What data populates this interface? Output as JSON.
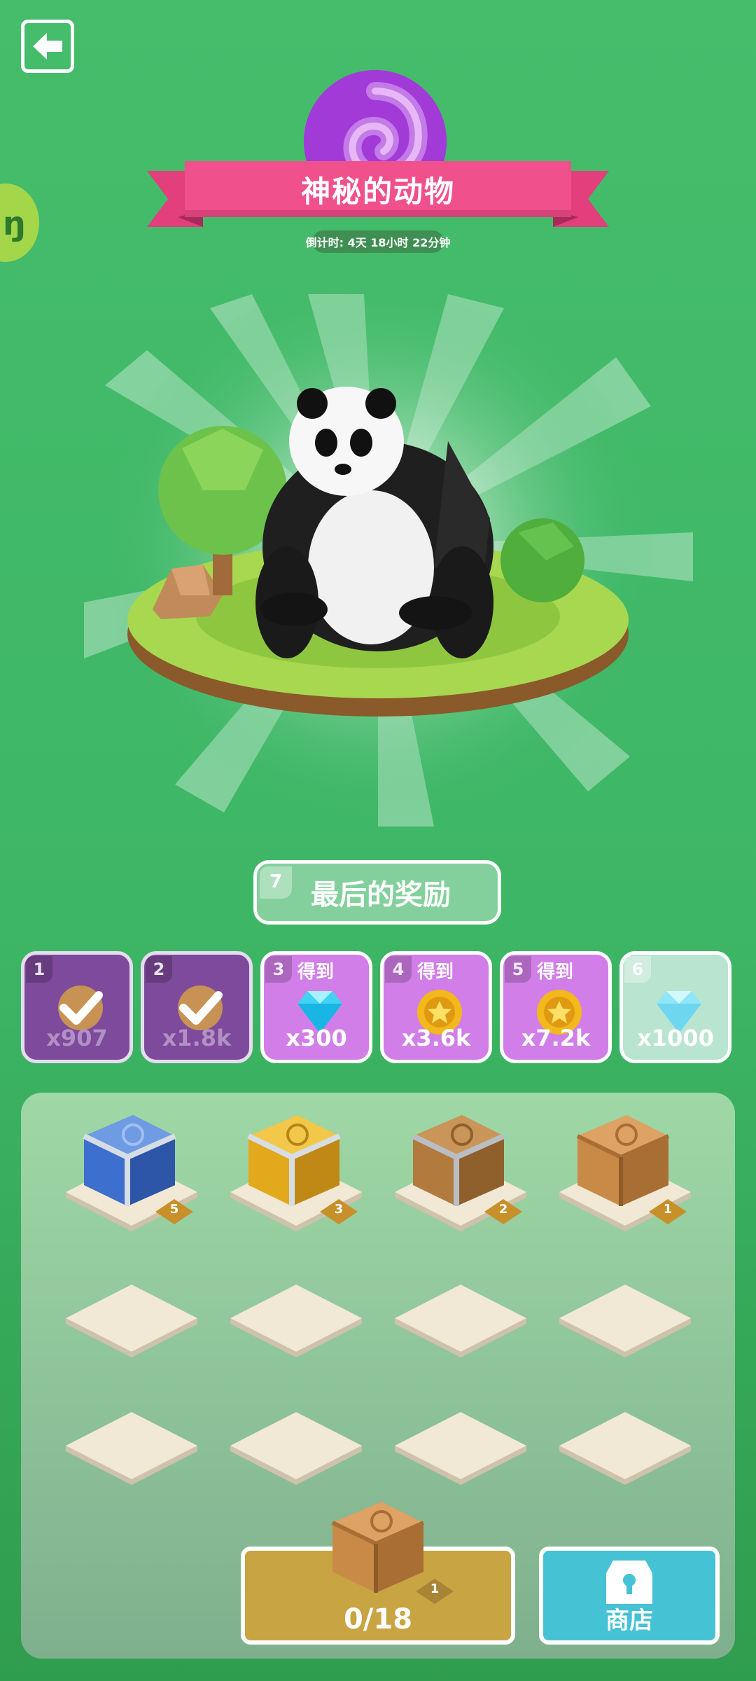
{
  "header": {
    "back_icon": "arrow-left-icon",
    "title": "神秘的动物",
    "countdown": "倒计时: 4天 18小时 22分钟",
    "side_tab_glyph": "ŋ",
    "colors": {
      "background": "#3db666",
      "ribbon": "#f0508c",
      "medal": "#a23ad8"
    }
  },
  "scene": {
    "animal": "panda-icon"
  },
  "final_reward": {
    "index": "7",
    "label": "最后的奖励"
  },
  "rewards": [
    {
      "index": "1",
      "state": "claimed",
      "icon": "checkmark-icon",
      "amount": "x907"
    },
    {
      "index": "2",
      "state": "claimed",
      "icon": "checkmark-icon",
      "amount": "x1.8k"
    },
    {
      "index": "3",
      "state": "available",
      "action": "得到",
      "icon": "diamond-icon",
      "amount": "x300"
    },
    {
      "index": "4",
      "state": "available",
      "action": "得到",
      "icon": "coin-icon",
      "amount": "x3.6k"
    },
    {
      "index": "5",
      "state": "available",
      "action": "得到",
      "icon": "coin-icon",
      "amount": "x7.2k"
    },
    {
      "index": "6",
      "state": "locked",
      "icon": "diamond-icon",
      "amount": "x1000"
    }
  ],
  "chests": [
    {
      "level": "5",
      "tier": "blue",
      "count": "5"
    },
    {
      "level": "3",
      "tier": "gold",
      "count": "3"
    },
    {
      "level": "2",
      "tier": "bronze",
      "count": "2"
    },
    {
      "level": "1",
      "tier": "wood",
      "count": "1"
    }
  ],
  "empty_slots": 8,
  "bottom": {
    "chest_level": "1",
    "chest_count": "1",
    "progress": "0/18",
    "shop_label": "商店",
    "shop_icon": "shop-lock-icon"
  }
}
